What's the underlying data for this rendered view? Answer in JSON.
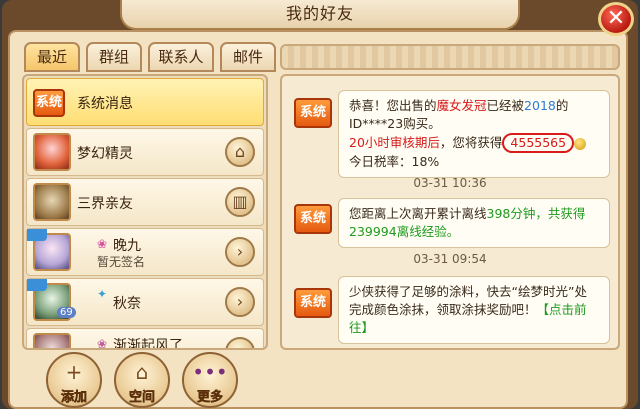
{
  "window": {
    "title": "我的好友",
    "close_glyph": "✕"
  },
  "tabs": [
    {
      "label": "最近"
    },
    {
      "label": "群组"
    },
    {
      "label": "联系人"
    },
    {
      "label": "邮件"
    }
  ],
  "list": {
    "items": [
      {
        "badge": "系统",
        "name": "系统消息"
      },
      {
        "name": "梦幻精灵",
        "action_icon": "home-icon",
        "action_glyph": "⌂"
      },
      {
        "name": "三界亲友",
        "action_icon": "book-icon",
        "action_glyph": "▥"
      },
      {
        "name": "晚九",
        "sub": "暂无签名",
        "action_glyph": "›"
      },
      {
        "name": "秋奈",
        "level": "69",
        "action_glyph": "›"
      },
      {
        "name": "渐渐起风了",
        "action_glyph": "›"
      }
    ]
  },
  "bottom_buttons": [
    {
      "label": "添加",
      "glyph": "+"
    },
    {
      "label": "空间",
      "glyph": "⌂"
    },
    {
      "label": "更多",
      "glyph": "•••"
    }
  ],
  "messages": [
    {
      "badge": "系统",
      "parts": {
        "p1": "恭喜！您出售的",
        "item": "魔女发冠",
        "p2": "已经被",
        "year": "2018",
        "p3": "的ID****23购买。",
        "after": "20小时审核期后",
        "p4": "，您将获得",
        "amount": "4555565",
        "tax": "今日税率：18%"
      },
      "time": "03-31 10:36"
    },
    {
      "badge": "系统",
      "parts": {
        "p1": "您距离上次离开累计离线",
        "mins": "398分钟，共获得239994离线经验。"
      },
      "time": "03-31 09:54"
    },
    {
      "badge": "系统",
      "parts": {
        "p1": "少侠获得了足够的涂料，快去“绘梦时光”处完成颜色涂抹，领取涂抹奖励吧！",
        "link": "【点击前往】"
      }
    }
  ],
  "colors": {
    "accent": "#e55a10",
    "highlight": "#ffdd73",
    "red": "#d81b1b",
    "green": "#1e9a1e",
    "blue": "#2d7bd1"
  }
}
